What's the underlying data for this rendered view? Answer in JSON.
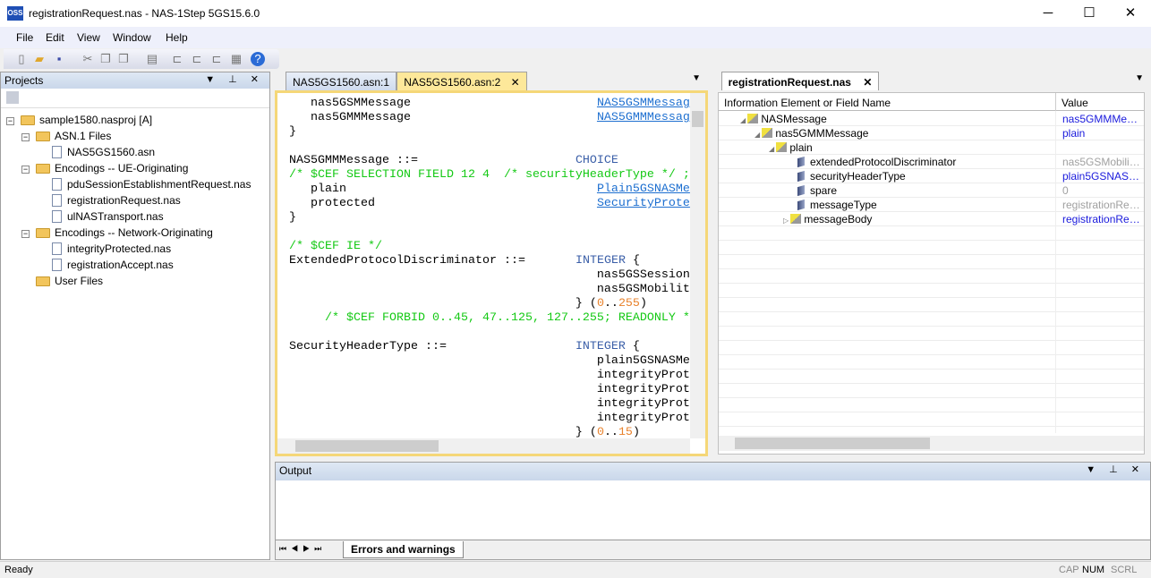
{
  "window": {
    "title": "registrationRequest.nas - NAS-1Step 5GS15.6.0",
    "app_icon": "OSS",
    "minimize": "─",
    "maximize": "☐",
    "close": "✕"
  },
  "menu": [
    "File",
    "Edit",
    "View",
    "Window",
    "Help"
  ],
  "toolbar": [
    "new-file-icon",
    "open-folder-icon",
    "save-icon",
    "cut-icon",
    "copy-icon",
    "paste-icon",
    "print-icon",
    "tree-1-icon",
    "tree-2-icon",
    "tree-3-icon",
    "table-icon",
    "help-icon"
  ],
  "projects": {
    "title": "Projects",
    "tree": [
      {
        "label": "sample1580.nasproj [A]",
        "type": "folder",
        "level": 0,
        "expanded": true
      },
      {
        "label": "ASN.1 Files",
        "type": "folder",
        "level": 1,
        "expanded": true
      },
      {
        "label": "NAS5GS1560.asn",
        "type": "file",
        "level": 2
      },
      {
        "label": "Encodings -- UE-Originating",
        "type": "folder",
        "level": 1,
        "expanded": true
      },
      {
        "label": "pduSessionEstablishmentRequest.nas",
        "type": "file",
        "level": 2
      },
      {
        "label": "registrationRequest.nas",
        "type": "file",
        "level": 2
      },
      {
        "label": "ulNASTransport.nas",
        "type": "file",
        "level": 2
      },
      {
        "label": "Encodings -- Network-Originating",
        "type": "folder",
        "level": 1,
        "expanded": true
      },
      {
        "label": "integrityProtected.nas",
        "type": "file",
        "level": 2
      },
      {
        "label": "registrationAccept.nas",
        "type": "file",
        "level": 2
      },
      {
        "label": "User Files",
        "type": "folder",
        "level": 1
      }
    ]
  },
  "editor": {
    "tabs": [
      {
        "label": "NAS5GS1560.asn:1",
        "active": false
      },
      {
        "label": "NAS5GS1560.asn:2",
        "active": true
      }
    ],
    "lines": [
      [
        [
          "   nas5GSMMessage",
          ""
        ],
        [
          "                          ",
          ""
        ],
        [
          "NAS5GSMMessag",
          "link"
        ]
      ],
      [
        [
          "   nas5GMMMessage",
          ""
        ],
        [
          "                          ",
          ""
        ],
        [
          "NAS5GMMMessag",
          "link"
        ]
      ],
      [
        [
          "}",
          ""
        ]
      ],
      [],
      [
        [
          "NAS5GMMMessage ::=",
          ""
        ],
        [
          "                      ",
          ""
        ],
        [
          "CHOICE",
          "kw"
        ]
      ],
      [
        [
          "/* $CEF SELECTION FIELD 12 4  /* securityHeaderType */ ;",
          "cm"
        ]
      ],
      [
        [
          "   plain",
          ""
        ],
        [
          "                                   ",
          ""
        ],
        [
          "Plain5GSNASMe",
          "link"
        ]
      ],
      [
        [
          "   protected",
          ""
        ],
        [
          "                               ",
          ""
        ],
        [
          "SecurityProte",
          "link"
        ]
      ],
      [
        [
          "}",
          ""
        ]
      ],
      [],
      [
        [
          "/* $CEF IE */",
          "cm"
        ]
      ],
      [
        [
          "ExtendedProtocolDiscriminator ::=",
          ""
        ],
        [
          "       ",
          ""
        ],
        [
          "INTEGER",
          "kw"
        ],
        [
          " {",
          ""
        ]
      ],
      [
        [
          "                                           nas5GSSession",
          ""
        ]
      ],
      [
        [
          "                                           nas5GSMobilit",
          ""
        ]
      ],
      [
        [
          "                                        } (",
          ""
        ],
        [
          "0",
          "num"
        ],
        [
          "..",
          ""
        ],
        [
          "255",
          "num"
        ],
        [
          ")",
          ""
        ]
      ],
      [
        [
          "     ",
          ""
        ],
        [
          "/* $CEF FORBID 0..45, 47..125, 127..255; READONLY *",
          "cm"
        ]
      ],
      [],
      [
        [
          "SecurityHeaderType ::=",
          ""
        ],
        [
          "                  ",
          ""
        ],
        [
          "INTEGER",
          "kw"
        ],
        [
          " {",
          ""
        ]
      ],
      [
        [
          "                                           plain5GSNASMe",
          ""
        ]
      ],
      [
        [
          "                                           integrityProt",
          ""
        ]
      ],
      [
        [
          "                                           integrityProt",
          ""
        ]
      ],
      [
        [
          "                                           integrityProt",
          ""
        ]
      ],
      [
        [
          "                                           integrityProt",
          ""
        ]
      ],
      [
        [
          "                                        } (",
          ""
        ],
        [
          "0",
          "num"
        ],
        [
          "..",
          ""
        ],
        [
          "15",
          "num"
        ],
        [
          ")",
          ""
        ]
      ]
    ]
  },
  "decoder": {
    "tab": "registrationRequest.nas",
    "columns": [
      "Information Element or Field Name",
      "Value"
    ],
    "rows": [
      {
        "name": "NASMessage",
        "value": "nas5GMMMessa...",
        "level": 0,
        "kind": "constructed",
        "toggle": "expanded",
        "value_style": "blue"
      },
      {
        "name": "nas5GMMMessage",
        "value": "plain",
        "level": 1,
        "kind": "constructed",
        "toggle": "expanded",
        "value_style": "blue"
      },
      {
        "name": "plain",
        "value": "",
        "level": 2,
        "kind": "constructed",
        "toggle": "expanded",
        "value_style": "blue"
      },
      {
        "name": "extendedProtocolDiscriminator",
        "value": "nas5GSMobility...",
        "level": 3,
        "kind": "field",
        "value_style": "gray"
      },
      {
        "name": "securityHeaderType",
        "value": "plain5GSNASMe...",
        "level": 3,
        "kind": "field",
        "value_style": "blue"
      },
      {
        "name": "spare",
        "value": "0",
        "level": 3,
        "kind": "field",
        "value_style": "gray"
      },
      {
        "name": "messageType",
        "value": "registrationRequ...",
        "level": 3,
        "kind": "field",
        "value_style": "gray"
      },
      {
        "name": "messageBody",
        "value": "registrationRequ...",
        "level": 3,
        "kind": "constructed",
        "toggle": "collapsed",
        "value_style": "blue"
      }
    ]
  },
  "output": {
    "title": "Output",
    "tabs": [
      "Errors and warnings"
    ]
  },
  "status": {
    "text": "Ready",
    "cap": "CAP",
    "num": "NUM",
    "scrl": "SCRL"
  },
  "colors": {
    "active_tab": "#fde89a",
    "code_border": "#f5d778",
    "keyword": "#3b5fa8",
    "comment": "#14c914",
    "number": "#e8822c",
    "link": "#1d6fd0",
    "value_blue": "#1a1adc",
    "value_gray": "#a0a0a0"
  }
}
